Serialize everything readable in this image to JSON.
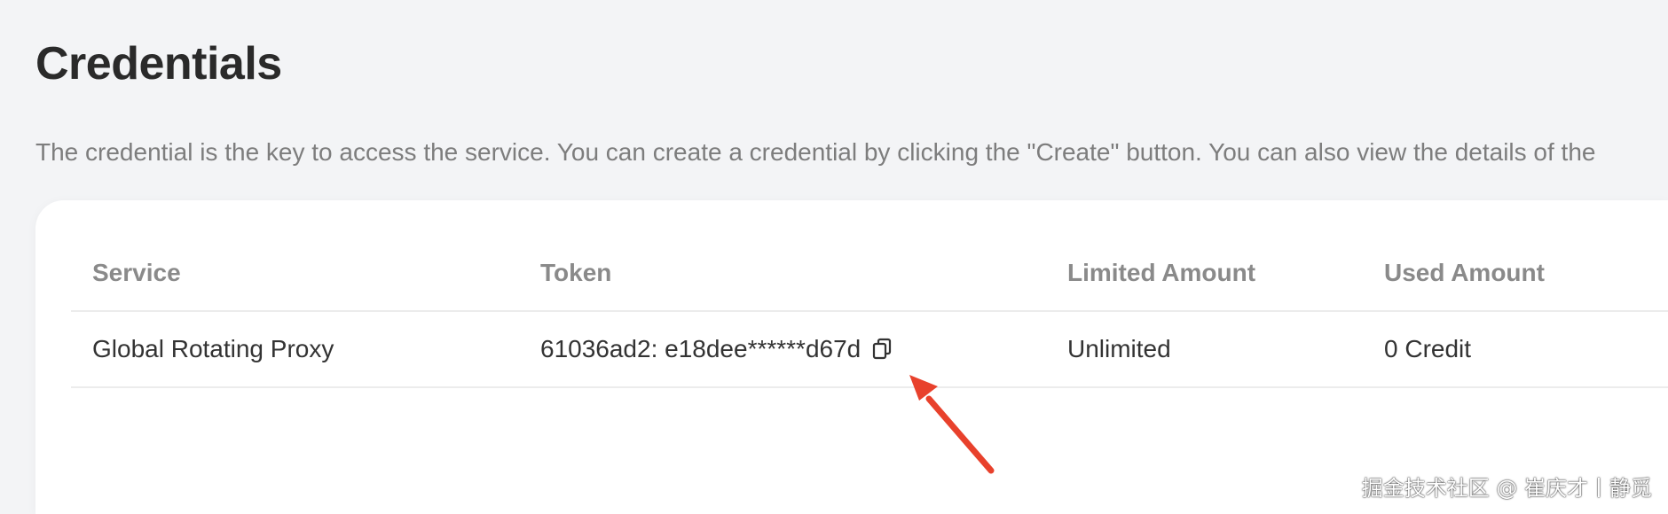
{
  "page": {
    "title": "Credentials",
    "description": "The credential is the key to access the service. You can create a credential by clicking the \"Create\" button. You can also view the details of the"
  },
  "table": {
    "columns": [
      "Service",
      "Token",
      "Limited Amount",
      "Used Amount"
    ],
    "rows": [
      {
        "service": "Global Rotating Proxy",
        "token": "61036ad2: e18dee******d67d",
        "limited_amount": "Unlimited",
        "used_amount": "0 Credit",
        "copy_icon": "copy-icon"
      }
    ]
  },
  "annotation": {
    "arrow_color": "#e8412c"
  },
  "watermark": {
    "text": "掘金技术社区 @ 崔庆才丨静觅"
  }
}
